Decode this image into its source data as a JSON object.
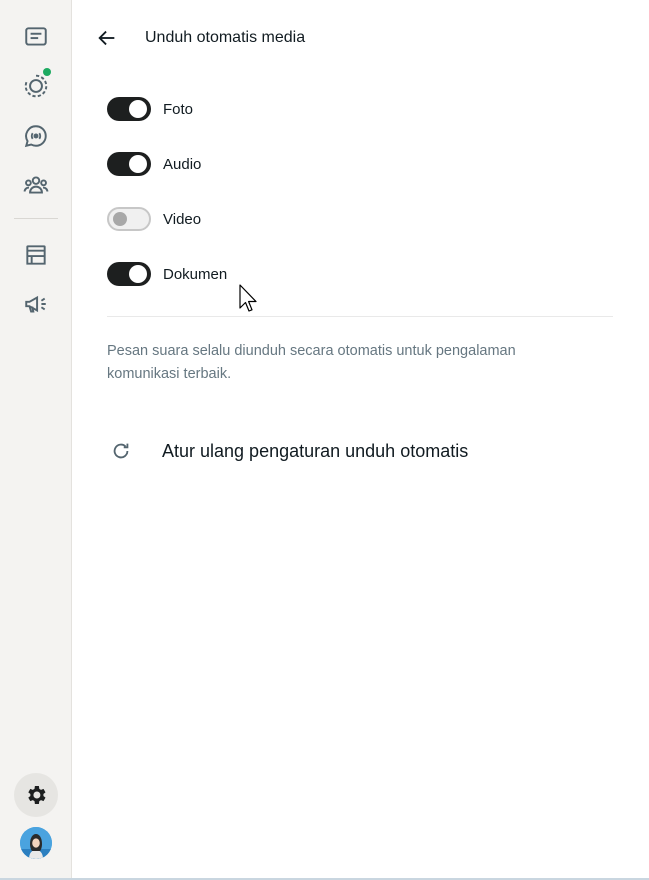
{
  "header": {
    "title": "Unduh otomatis media"
  },
  "toggles": [
    {
      "label": "Foto",
      "on": true
    },
    {
      "label": "Audio",
      "on": true
    },
    {
      "label": "Video",
      "on": false
    },
    {
      "label": "Dokumen",
      "on": true
    }
  ],
  "note": "Pesan suara selalu diunduh secara otomatis untuk pengalaman komunikasi terbaik.",
  "reset": {
    "label": "Atur ulang pengaturan unduh otomatis"
  },
  "sidebar": {
    "items": [
      {
        "icon": "chats-icon"
      },
      {
        "icon": "status-icon",
        "badge": "new"
      },
      {
        "icon": "channels-icon"
      },
      {
        "icon": "communities-icon"
      },
      {
        "icon": "store-icon"
      },
      {
        "icon": "megaphone-icon"
      }
    ],
    "settings_icon": "gear-icon"
  },
  "colors": {
    "accent": "#1daa61",
    "switch_on": "#1d1f1f",
    "text": "#111b21",
    "muted": "#667781"
  }
}
